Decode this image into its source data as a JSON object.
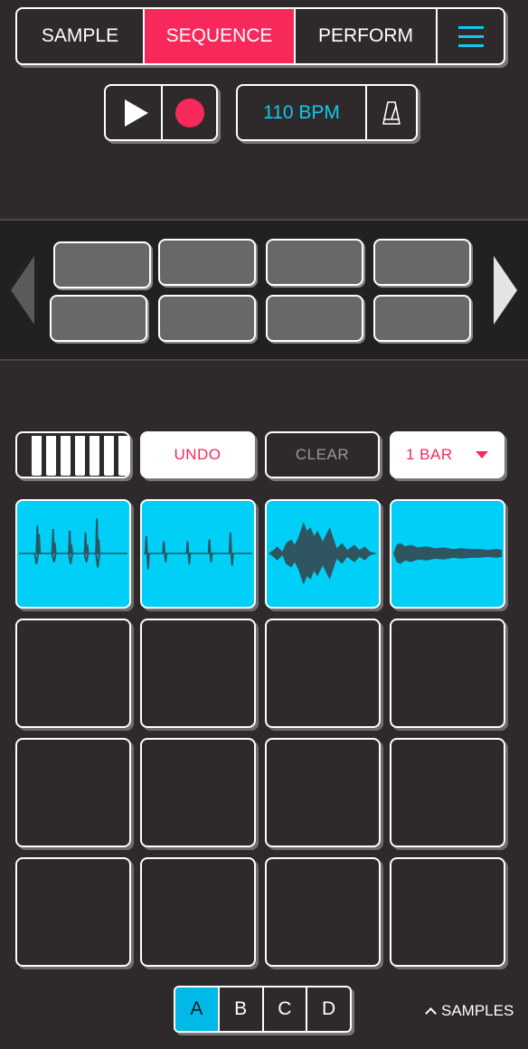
{
  "tabs": [
    {
      "label": "SAMPLE"
    },
    {
      "label": "SEQUENCE"
    },
    {
      "label": "PERFORM"
    }
  ],
  "transport": {
    "bpm_label": "110 BPM"
  },
  "controls": {
    "undo_label": "UNDO",
    "clear_label": "CLEAR",
    "length_label": "1 BAR"
  },
  "banks": [
    "A",
    "B",
    "C",
    "D"
  ],
  "footer": {
    "samples_label": "SAMPLES"
  },
  "colors": {
    "accent": "#f7295a",
    "cyan": "#00d0f7",
    "background": "#2e2a2b"
  }
}
